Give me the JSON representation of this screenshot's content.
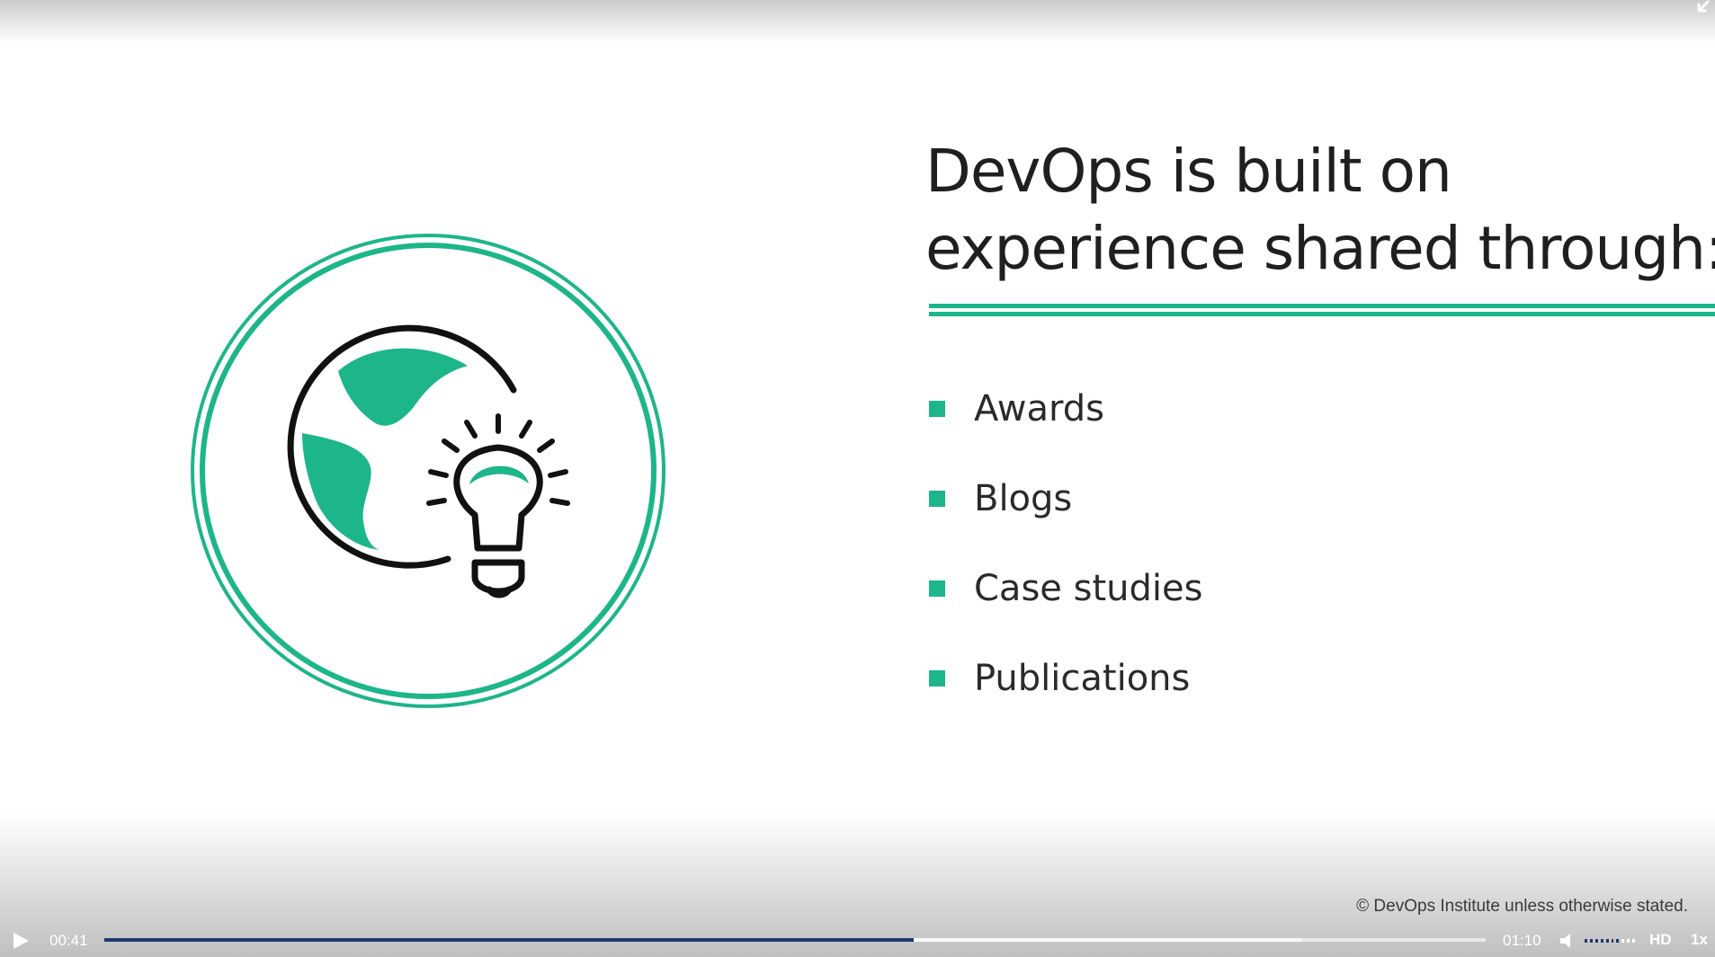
{
  "slide": {
    "title_lines": [
      "DevOps is built on",
      "experience shared through:"
    ],
    "bullets": [
      "Awards",
      "Blogs",
      "Case studies",
      "Publications"
    ],
    "footer": "© DevOps Institute unless otherwise stated.",
    "emblem_icon": "globe-with-lightbulb-icon"
  },
  "player": {
    "current_time": "00:41",
    "total_time": "01:10",
    "progress": 0.586,
    "buffered": 0.867,
    "volume_level": 0.7,
    "quality_label": "HD",
    "speed_label": "1x"
  },
  "colors": {
    "accent_green": "#1db58a",
    "played_bar": "#1e3a70",
    "icon_stroke": "#111111"
  }
}
